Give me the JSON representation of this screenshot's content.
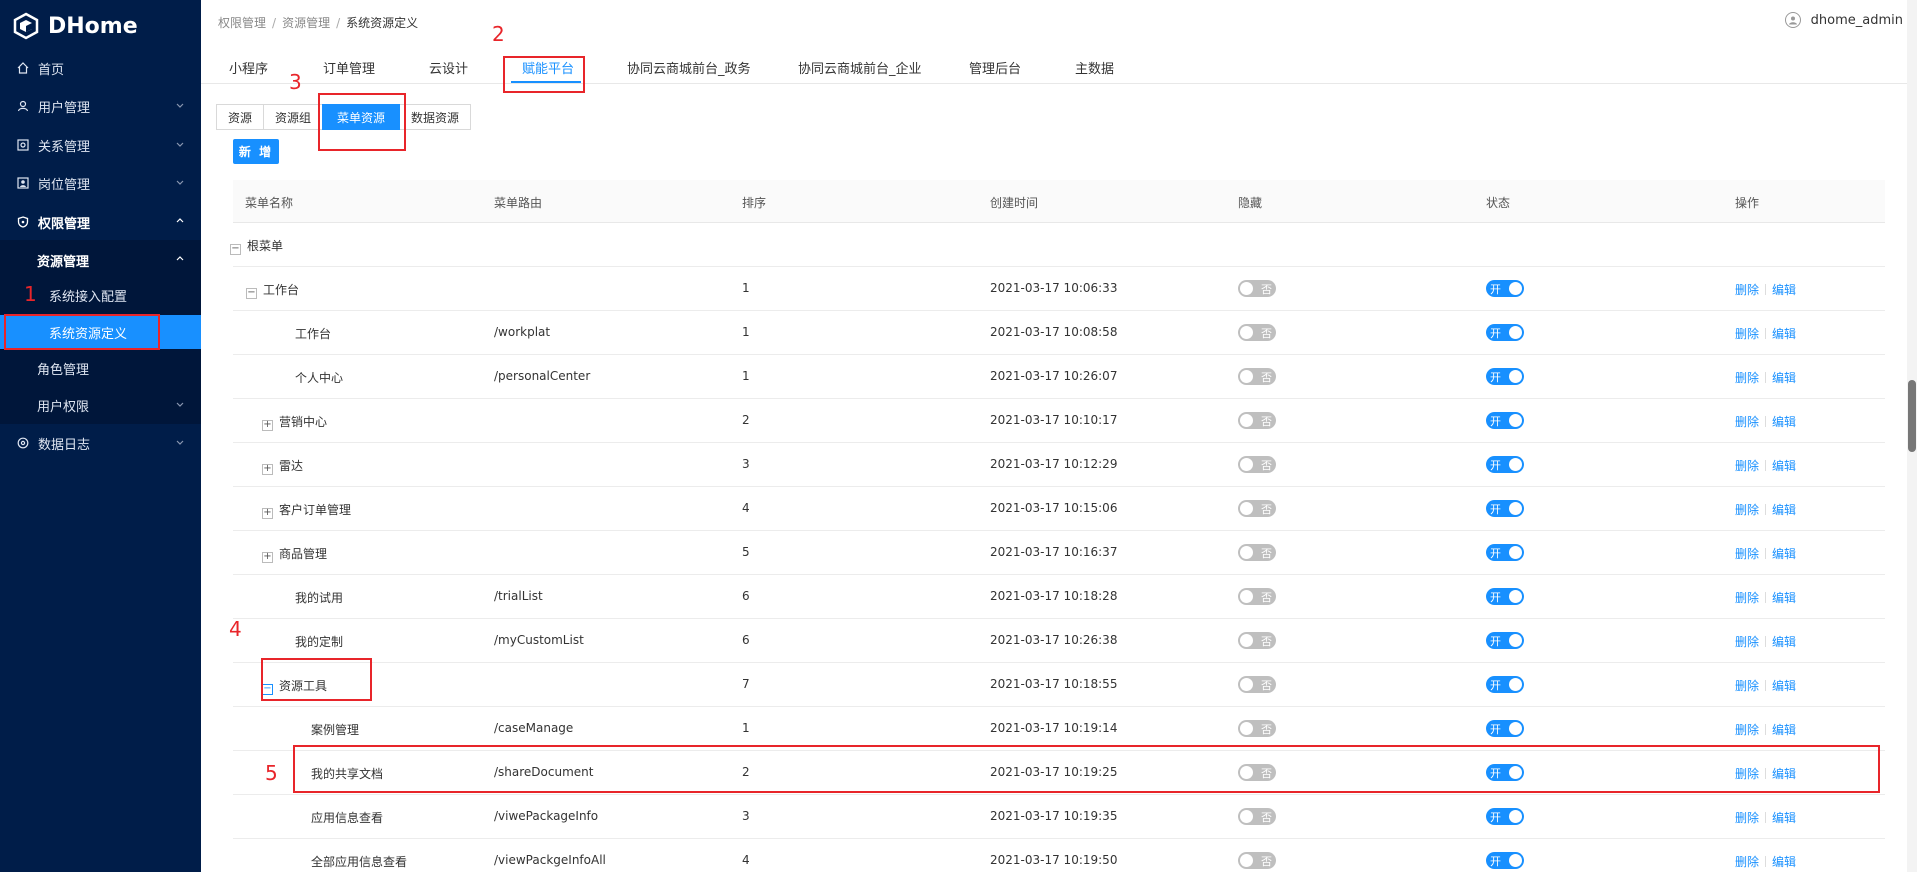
{
  "app": {
    "title": "DHome"
  },
  "sidebar": {
    "items": [
      {
        "label": "首页",
        "icon": "home-icon"
      },
      {
        "label": "用户管理",
        "icon": "user-icon"
      },
      {
        "label": "关系管理",
        "icon": "relation-icon"
      },
      {
        "label": "岗位管理",
        "icon": "badge-icon"
      },
      {
        "label": "权限管理",
        "icon": "shield-icon"
      },
      {
        "label": "资源管理"
      },
      {
        "label": "系统接入配置"
      },
      {
        "label": "系统资源定义"
      },
      {
        "label": "角色管理"
      },
      {
        "label": "用户权限"
      },
      {
        "label": "数据日志",
        "icon": "log-icon"
      }
    ]
  },
  "header": {
    "breadcrumb": [
      "权限管理",
      "资源管理",
      "系统资源定义"
    ],
    "user": "dhome_admin"
  },
  "top_tabs": [
    "小程序",
    "订单管理",
    "云设计",
    "赋能平台",
    "协同云商城前台_政务",
    "协同云商城前台_企业",
    "管理后台",
    "主数据"
  ],
  "resource_tabs": [
    "资源",
    "资源组",
    "菜单资源",
    "数据资源"
  ],
  "add_button": "新 增",
  "table": {
    "headers": [
      "菜单名称",
      "菜单路由",
      "排序",
      "创建时间",
      "隐藏",
      "状态",
      "操作"
    ],
    "switch_off_label": "否",
    "switch_on_label": "开",
    "op_delete": "删除",
    "op_edit": "编辑",
    "rows": [
      {
        "name": "根菜单",
        "route": "",
        "order": "",
        "created": "",
        "expander": "-"
      },
      {
        "name": "工作台",
        "route": "",
        "order": "1",
        "created": "2021-03-17 10:06:33",
        "expander": "-"
      },
      {
        "name": "工作台",
        "route": "/workplat",
        "order": "1",
        "created": "2021-03-17 10:08:58"
      },
      {
        "name": "个人中心",
        "route": "/personalCenter",
        "order": "1",
        "created": "2021-03-17 10:26:07"
      },
      {
        "name": "营销中心",
        "route": "",
        "order": "2",
        "created": "2021-03-17 10:10:17",
        "expander": "+"
      },
      {
        "name": "雷达",
        "route": "",
        "order": "3",
        "created": "2021-03-17 10:12:29",
        "expander": "+"
      },
      {
        "name": "客户订单管理",
        "route": "",
        "order": "4",
        "created": "2021-03-17 10:15:06",
        "expander": "+"
      },
      {
        "name": "商品管理",
        "route": "",
        "order": "5",
        "created": "2021-03-17 10:16:37",
        "expander": "+"
      },
      {
        "name": "我的试用",
        "route": "/trialList",
        "order": "6",
        "created": "2021-03-17 10:18:28"
      },
      {
        "name": "我的定制",
        "route": "/myCustomList",
        "order": "6",
        "created": "2021-03-17 10:26:38"
      },
      {
        "name": "资源工具",
        "route": "",
        "order": "7",
        "created": "2021-03-17 10:18:55",
        "expander": "-"
      },
      {
        "name": "案例管理",
        "route": "/caseManage",
        "order": "1",
        "created": "2021-03-17 10:19:14"
      },
      {
        "name": "我的共享文档",
        "route": "/shareDocument",
        "order": "2",
        "created": "2021-03-17 10:19:25"
      },
      {
        "name": "应用信息查看",
        "route": "/viwePackageInfo",
        "order": "3",
        "created": "2021-03-17 10:19:35"
      },
      {
        "name": "全部应用信息查看",
        "route": "/viewPackgeInfoAll",
        "order": "4",
        "created": "2021-03-17 10:19:50"
      }
    ]
  },
  "annotations": [
    "1",
    "2",
    "3",
    "4",
    "5"
  ]
}
